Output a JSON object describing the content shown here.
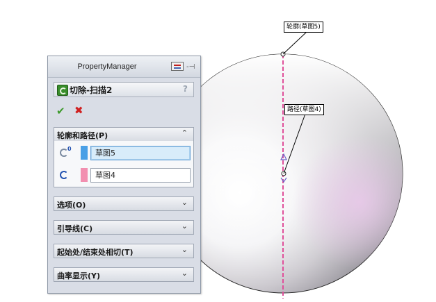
{
  "property_manager": {
    "title": "PropertyManager",
    "feature_title": "切除-扫描2",
    "help_label": "?",
    "ok_icon": "✔",
    "cancel_icon": "✖",
    "sections": [
      {
        "label": "轮廓和路径(P)",
        "expanded": true,
        "arrow": "≈"
      },
      {
        "label": "选项(O)",
        "expanded": false,
        "arrow": "≈"
      },
      {
        "label": "引导线(C)",
        "expanded": false,
        "arrow": "≈"
      },
      {
        "label": "起始处/结束处相切(T)",
        "expanded": false,
        "arrow": "≈"
      },
      {
        "label": "曲率显示(Y)",
        "expanded": false,
        "arrow": "≈"
      }
    ],
    "profile_field": {
      "value": "草图5",
      "swatch_color": "#4aa0e6",
      "active": true
    },
    "path_field": {
      "value": "草图4",
      "swatch_color": "#f28fb0",
      "active": false
    }
  },
  "viewport": {
    "profile_callout": "轮廓(草图5)",
    "path_callout": "路径(草图4)",
    "path_color": "#e0509a"
  },
  "icons": [
    "sweep-cut-feature-icon",
    "check-icon",
    "close-icon",
    "pin-icon",
    "profile-icon",
    "path-icon"
  ]
}
